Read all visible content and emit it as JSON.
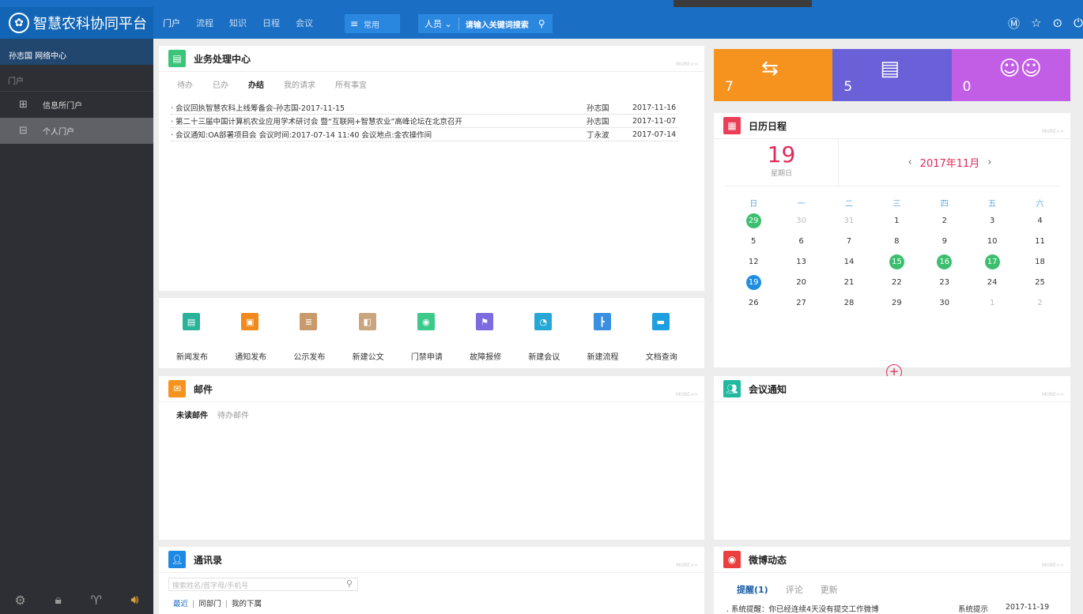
{
  "app": {
    "title": "智慧农科协同平台"
  },
  "topnav": {
    "items": [
      "门户",
      "流程",
      "知识",
      "日程",
      "会议"
    ],
    "menu_label": "常用",
    "search_scope": "人员",
    "search_placeholder": "请输入关键词搜索"
  },
  "sidebar": {
    "user": "孙志国 网络中心",
    "group": "门户",
    "items": [
      {
        "label": "信息所门户",
        "icon": "layout-icon"
      },
      {
        "label": "个人门户",
        "icon": "layout-icon"
      }
    ]
  },
  "business": {
    "title": "业务处理中心",
    "more": "MORE>>",
    "tabs": [
      "待办",
      "已办",
      "办结",
      "我的请求",
      "所有事宜"
    ],
    "active_tab": "办结",
    "rows": [
      {
        "title": "· 会议回执智慧农科上线筹备会-孙志国-2017-11-15",
        "author": "孙志国",
        "date": "2017-11-16"
      },
      {
        "title": "· 第二十三届中国计算机农业应用学术研讨会 暨“互联网+智慧农业”高峰论坛在北京召开",
        "author": "孙志国",
        "date": "2017-11-07"
      },
      {
        "title": "· 会议通知:OA部署项目会 会议时间:2017-07-14 11:40 会议地点:金农操作间",
        "author": "丁永波",
        "date": "2017-07-14"
      }
    ]
  },
  "shortcuts": [
    {
      "label": "新闻发布",
      "color": "#2bb39a"
    },
    {
      "label": "通知发布",
      "color": "#f08a1c"
    },
    {
      "label": "公示发布",
      "color": "#c99a6b"
    },
    {
      "label": "新建公文",
      "color": "#c9a67e"
    },
    {
      "label": "门禁申请",
      "color": "#3cc98a"
    },
    {
      "label": "故障报修",
      "color": "#7d6be0"
    },
    {
      "label": "新建会议",
      "color": "#27a7d6"
    },
    {
      "label": "新建流程",
      "color": "#3a8fe0"
    },
    {
      "label": "文档查询",
      "color": "#1ea0e0"
    }
  ],
  "tiles": [
    {
      "count": "7",
      "color": "#f6931e"
    },
    {
      "count": "5",
      "color": "#6a61d8"
    },
    {
      "count": "0",
      "color": "#c25ee6"
    }
  ],
  "calendar": {
    "title": "日历日程",
    "more": "MORE>>",
    "day": "19",
    "weekday": "星期日",
    "month_label": "2017年11月",
    "weekdays": [
      "日",
      "一",
      "二",
      "三",
      "四",
      "五",
      "六"
    ],
    "weeks": [
      [
        "29",
        "30",
        "31",
        "1",
        "2",
        "3",
        "4"
      ],
      [
        "5",
        "6",
        "7",
        "8",
        "9",
        "10",
        "11"
      ],
      [
        "12",
        "13",
        "14",
        "15",
        "16",
        "17",
        "18"
      ],
      [
        "19",
        "20",
        "21",
        "22",
        "23",
        "24",
        "25"
      ],
      [
        "26",
        "27",
        "28",
        "29",
        "30",
        "1",
        "2"
      ]
    ]
  },
  "mail": {
    "title": "邮件",
    "more": "MORE>>",
    "tabs": [
      "未读邮件",
      "待办邮件"
    ]
  },
  "meeting": {
    "title": "会议通知",
    "more": "MORE>>"
  },
  "contacts": {
    "title": "通讯录",
    "more": "MORE>>",
    "search_placeholder": "搜索姓名/首字母/手机号",
    "tabs": [
      "最近",
      "同部门",
      "我的下属"
    ]
  },
  "weibo": {
    "title": "微博动态",
    "more": "MORE>>",
    "tabs": [
      "提醒(1)",
      "评论",
      "更新"
    ],
    "row": {
      "title": ". 系统提醒：你已经连续4天没有提交工作微博",
      "author": "系统提示",
      "date": "2017-11-19"
    }
  }
}
